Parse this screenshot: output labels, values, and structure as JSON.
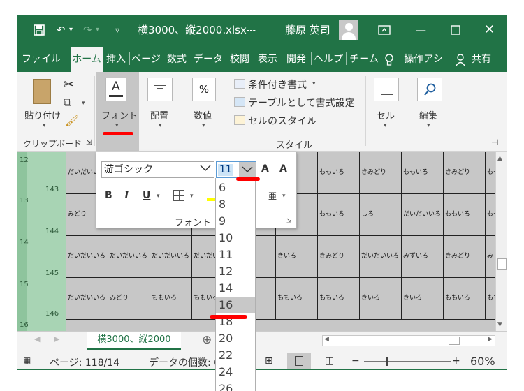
{
  "titlebar": {
    "filename": "横3000、縦2000.xlsx",
    "ellipsis": "---",
    "user": "藤原 英司"
  },
  "tabs": [
    "ファイル",
    "ホーム",
    "挿入",
    "ページ",
    "数式",
    "データ",
    "校閲",
    "表示",
    "開発",
    "ヘルプ",
    "チーム",
    "操作アシ",
    "共有"
  ],
  "ribbon": {
    "paste": "貼り付け",
    "clipboard": "クリップボード",
    "font": "フォント",
    "align": "配置",
    "number": "数値",
    "percent": "%",
    "cond_format": "条件付き書式",
    "table_format": "テーブルとして書式設定",
    "cell_style": "セルのスタイル",
    "cells": "セル",
    "edit": "編集",
    "style_group": "スタイル"
  },
  "font_panel": {
    "font_name": "游ゴシック",
    "font_size": "11",
    "bold": "B",
    "italic": "I",
    "underline": "U",
    "grow": "A",
    "shrink": "A",
    "title": "フォント"
  },
  "size_options": [
    "6",
    "8",
    "9",
    "10",
    "11",
    "12",
    "14",
    "16",
    "18",
    "20",
    "22",
    "24",
    "26"
  ],
  "selected_size": "16",
  "sheet": {
    "row_numbers": [
      "143",
      "144",
      "145",
      "146"
    ],
    "side_numbers": [
      "12",
      "13",
      "14",
      "15",
      "16"
    ],
    "rows": [
      [
        "だいだいいろ",
        "",
        "",
        "",
        "",
        "",
        "ももいろ",
        "きみどり",
        "ももいろ",
        "きみどり",
        "ももいろ"
      ],
      [
        "みどり",
        "",
        "",
        "",
        "",
        "ろ",
        "ももいろ",
        "しろ",
        "だいだいいろ",
        "ももいろ",
        "ももいろ"
      ],
      [
        "だいだいいろ",
        "だいだいいろ",
        "だいだいいろ",
        "だいだいいろ",
        "",
        "きいろ",
        "きみどり",
        "だいだいいろ",
        "みずいろ",
        "きみどり",
        "み"
      ],
      [
        "だいだいいろ",
        "みどり",
        "ももいろ",
        "ももいろ",
        "",
        "ももいろ",
        "ももいろ",
        "きいろ",
        "きいろ",
        "ももいろ",
        "ももいろ"
      ]
    ]
  },
  "sheet_tab": "横3000、縦2000",
  "status": {
    "page": "ページ: 118/14",
    "count": "データの個数: 6",
    "zoom": "60%",
    "minus": "−",
    "plus": "+"
  }
}
